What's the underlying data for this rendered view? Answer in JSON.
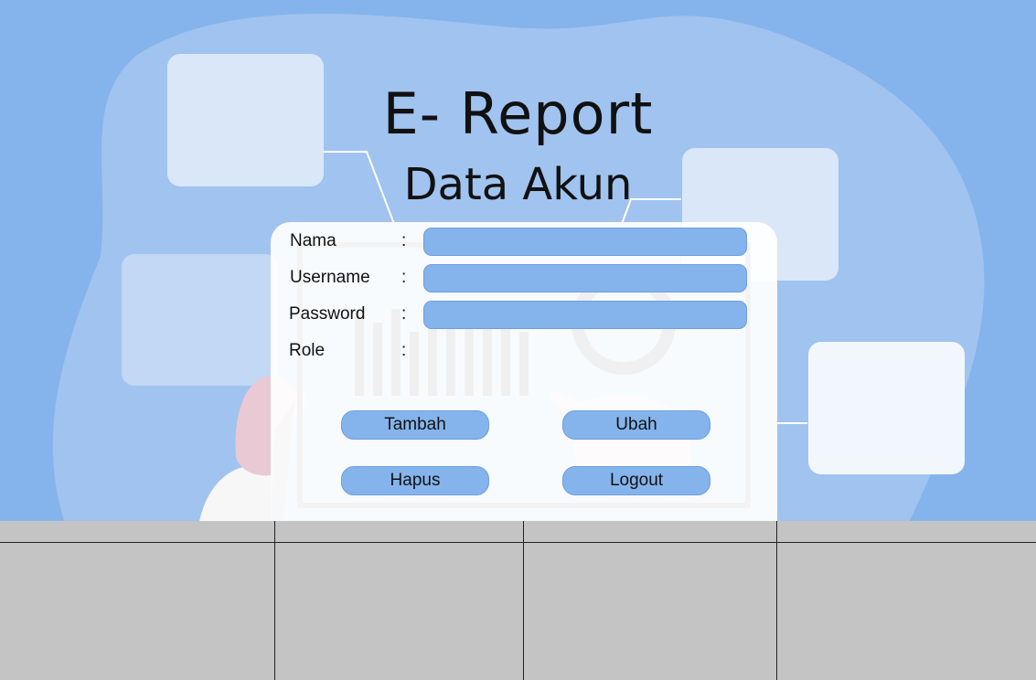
{
  "header": {
    "app_title": "E- Report",
    "page_title": "Data Akun"
  },
  "form": {
    "fields": [
      {
        "label": "Nama",
        "colon": ":",
        "value": ""
      },
      {
        "label": "Username",
        "colon": ":",
        "value": ""
      },
      {
        "label": "Password",
        "colon": ":",
        "value": ""
      },
      {
        "label": "Role",
        "colon": ":"
      }
    ]
  },
  "buttons": {
    "add": "Tambah",
    "edit": "Ubah",
    "delete": "Hapus",
    "logout": "Logout"
  },
  "table": {
    "columns": [
      "",
      "",
      "",
      ""
    ],
    "rows": []
  },
  "colors": {
    "background": "#85b4ec",
    "field": "#85b4ec",
    "button": "#85b4ec",
    "table": "#c4c4c4"
  }
}
